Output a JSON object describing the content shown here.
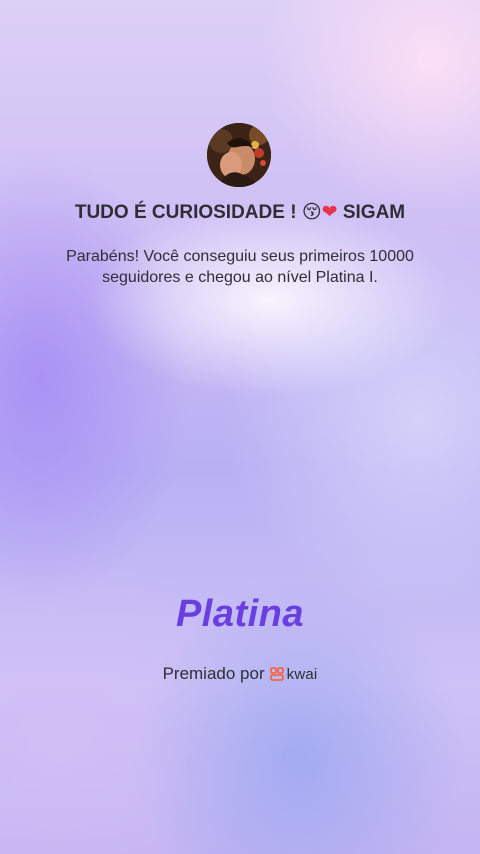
{
  "header": {
    "title_text": "TUDO É CURIOSIDADE !",
    "title_emoji_kiss": "😚",
    "title_emoji_heart": "❤",
    "title_suffix": "SIGAM"
  },
  "message": {
    "line1": "Parabéns! Você conseguiu seus primeiros 10000",
    "line2": "seguidores e chegou ao nível Platina I."
  },
  "level": {
    "name": "Platina"
  },
  "award": {
    "prefix": "Premiado por",
    "brand": "kwai"
  },
  "colors": {
    "level_accent": "#6a3fe0",
    "kwai_brand": "#ff5a2c",
    "heart": "#e8344a"
  }
}
